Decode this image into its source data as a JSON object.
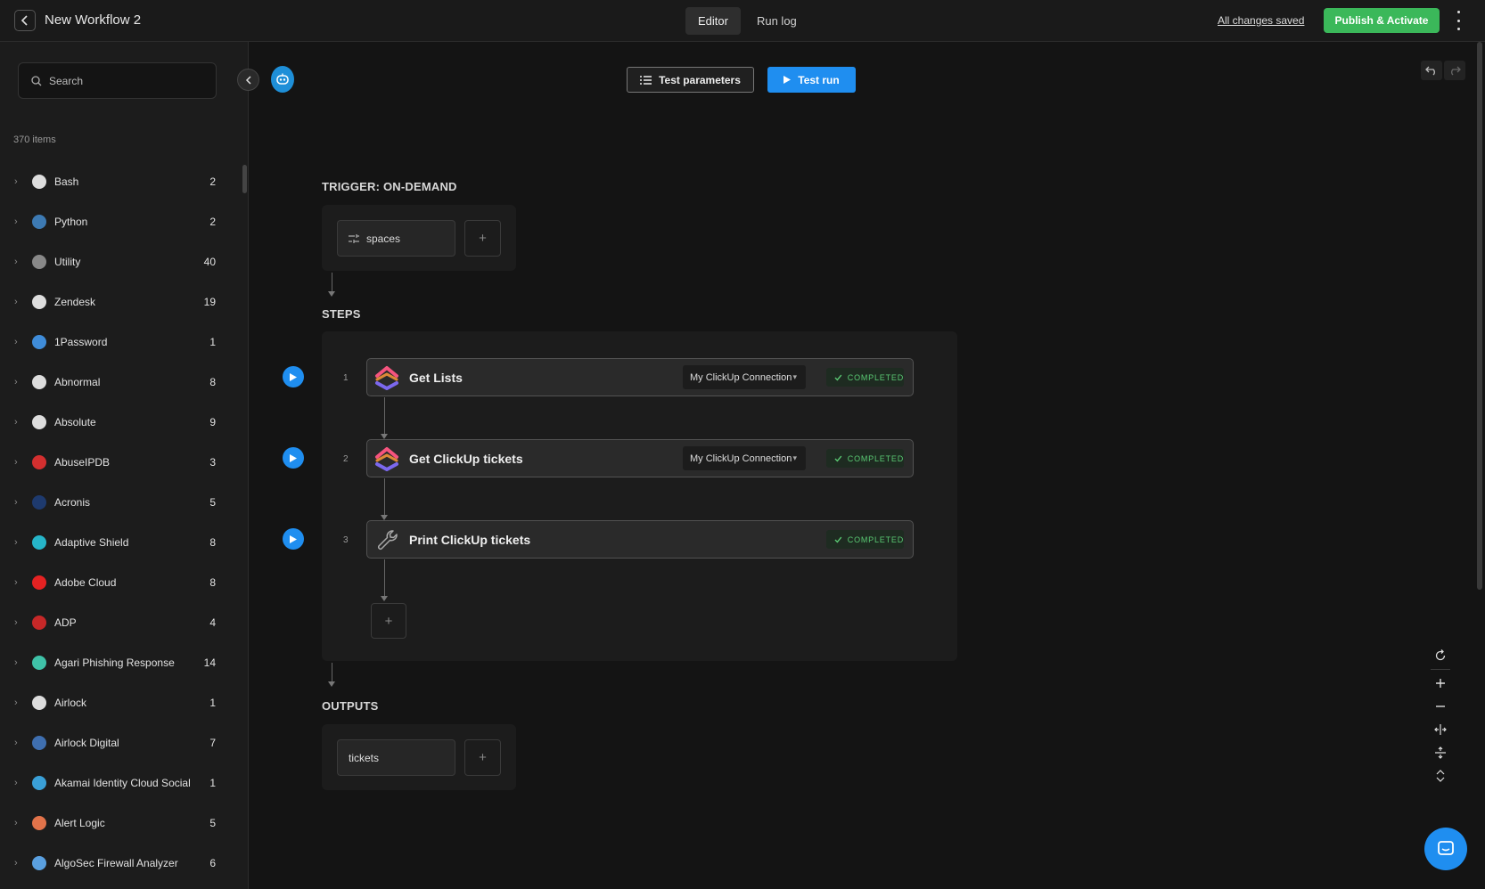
{
  "header": {
    "title": "New Workflow 2",
    "tabs": [
      {
        "label": "Editor",
        "active": true
      },
      {
        "label": "Run log",
        "active": false
      }
    ],
    "saved_status": "All changes saved",
    "publish_label": "Publish & Activate"
  },
  "sidebar": {
    "search_placeholder": "Search",
    "item_count": "370 items",
    "items": [
      {
        "name": "Bash",
        "count": "2",
        "icon_color": "#dddddd"
      },
      {
        "name": "Python",
        "count": "2",
        "icon_color": "#3d7ab3"
      },
      {
        "name": "Utility",
        "count": "40",
        "icon_color": "#888888"
      },
      {
        "name": "Zendesk",
        "count": "19",
        "icon_color": "#dddddd"
      },
      {
        "name": "1Password",
        "count": "1",
        "icon_color": "#3f8cd9"
      },
      {
        "name": "Abnormal",
        "count": "8",
        "icon_color": "#dddddd"
      },
      {
        "name": "Absolute",
        "count": "9",
        "icon_color": "#dddddd"
      },
      {
        "name": "AbuseIPDB",
        "count": "3",
        "icon_color": "#d32f2f"
      },
      {
        "name": "Acronis",
        "count": "5",
        "icon_color": "#1e3a6e"
      },
      {
        "name": "Adaptive Shield",
        "count": "8",
        "icon_color": "#26b5c9"
      },
      {
        "name": "Adobe Cloud",
        "count": "8",
        "icon_color": "#e52222"
      },
      {
        "name": "ADP",
        "count": "4",
        "icon_color": "#c62828"
      },
      {
        "name": "Agari Phishing Response",
        "count": "14",
        "icon_color": "#3fc2a8"
      },
      {
        "name": "Airlock",
        "count": "1",
        "icon_color": "#dddddd"
      },
      {
        "name": "Airlock Digital",
        "count": "7",
        "icon_color": "#3f6fb0"
      },
      {
        "name": "Akamai Identity Cloud Social",
        "count": "1",
        "icon_color": "#3aa0d8"
      },
      {
        "name": "Alert Logic",
        "count": "5",
        "icon_color": "#e2734a"
      },
      {
        "name": "AlgoSec Firewall Analyzer",
        "count": "6",
        "icon_color": "#5aa0e0"
      }
    ]
  },
  "toolbar": {
    "test_params_label": "Test parameters",
    "test_run_label": "Test run"
  },
  "canvas": {
    "trigger_label": "TRIGGER: ON-DEMAND",
    "trigger_param": "spaces",
    "steps_label": "STEPS",
    "steps": [
      {
        "num": "1",
        "name": "Get Lists",
        "connection": "My ClickUp Connection",
        "status": "COMPLETED",
        "icon": "clickup-icon"
      },
      {
        "num": "2",
        "name": "Get ClickUp tickets",
        "connection": "My ClickUp Connection",
        "status": "COMPLETED",
        "icon": "clickup-icon"
      },
      {
        "num": "3",
        "name": "Print ClickUp tickets",
        "status": "COMPLETED",
        "icon": "wrench-icon"
      }
    ],
    "add_symbol": "+",
    "outputs_label": "OUTPUTS",
    "output_param": "tickets"
  },
  "colors": {
    "accent_blue": "#1f8ef0",
    "publish_green": "#3bb85a",
    "completed_green": "#5ac873"
  }
}
